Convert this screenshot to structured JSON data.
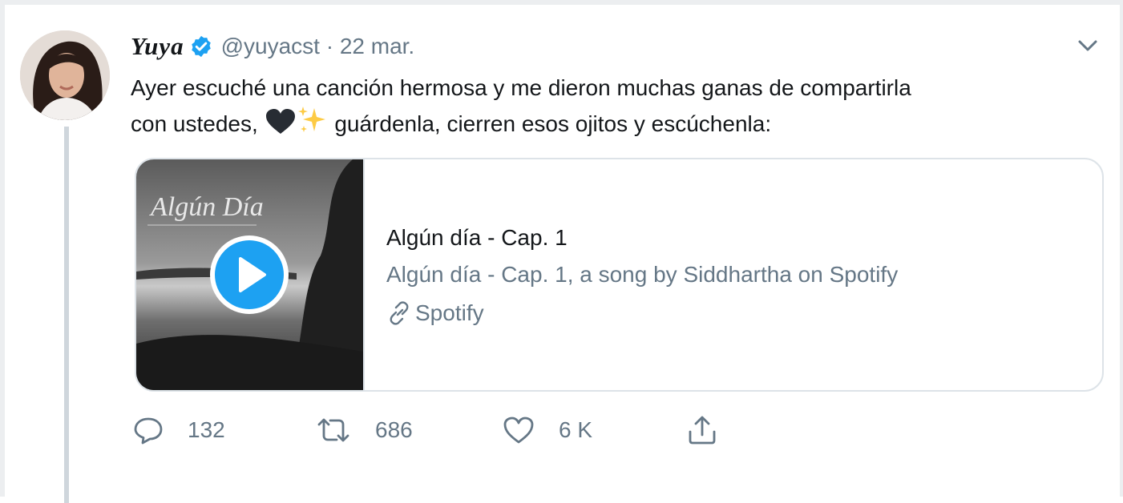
{
  "tweet": {
    "author_name": "Yuya",
    "handle_date": "@yuyacst · 22 mar.",
    "text_line1": "Ayer escuché una canción hermosa y me dieron muchas ganas de compartirla",
    "text_line2_before": "con ustedes, ",
    "text_line2_after": " guárdenla, cierren esos ojitos y escúchenla:",
    "emoji": [
      "black-heart-icon",
      "sparkles-icon"
    ]
  },
  "card": {
    "cover_title": "Algún Día",
    "title": "Algún día - Cap. 1",
    "description": "Algún día - Cap. 1, a song by Siddhartha on Spotify",
    "domain": "Spotify"
  },
  "actions": {
    "replies": "132",
    "retweets": "686",
    "likes": "6 K"
  },
  "colors": {
    "verified": "#1da1f2",
    "play": "#1da1f2",
    "secondary_text": "#657786",
    "border": "#dde3e8",
    "thread_line": "#cfd6dc"
  }
}
